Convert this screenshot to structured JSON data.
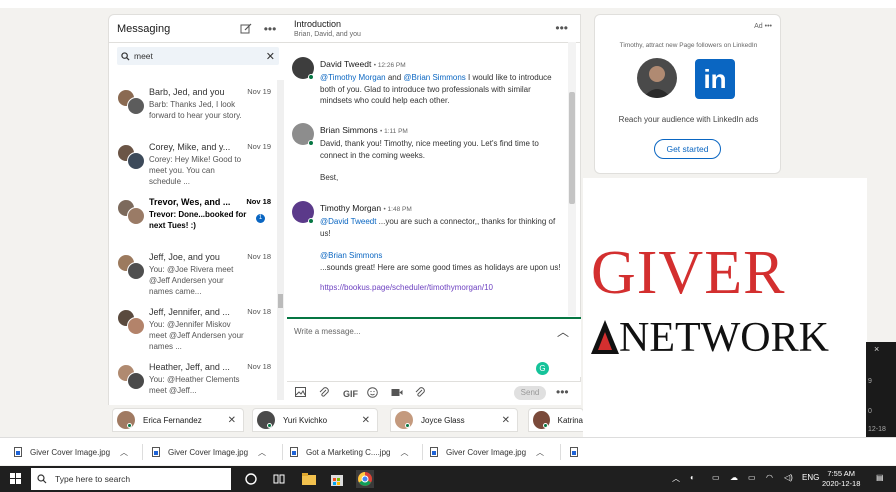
{
  "messaging": {
    "title": "Messaging",
    "search_value": "meet",
    "conversations": [
      {
        "name": "Barb, Jed, and you",
        "date": "Nov 19",
        "preview": "Barb: Thanks Jed, I look forward to hear your story.",
        "unread": false
      },
      {
        "name": "Corey, Mike, and y...",
        "date": "Nov 19",
        "preview": "Corey: Hey Mike! Good to meet you. You can schedule ...",
        "unread": false
      },
      {
        "name": "Trevor, Wes, and ...",
        "date": "Nov 18",
        "preview": "Trevor: Done...booked for next Tues! :)",
        "unread": true,
        "badge": "1"
      },
      {
        "name": "Jeff, Joe, and you",
        "date": "Nov 18",
        "preview": "You: @Joe Rivera meet @Jeff Andersen your names came...",
        "unread": false
      },
      {
        "name": "Jeff, Jennifer, and ...",
        "date": "Nov 18",
        "preview": "You: @Jennifer Miskov meet @Jeff Andersen your names ...",
        "unread": false
      },
      {
        "name": "Heather, Jeff, and ...",
        "date": "Nov 18",
        "preview": "You: @Heather Clements meet @Jeff...",
        "unread": false
      }
    ]
  },
  "chat": {
    "title": "Introduction",
    "subtitle": "Brian, David, and you",
    "messages": [
      {
        "sender": "David Tweedt",
        "time": "• 12:26 PM",
        "parts": [
          "@Timothy Morgan",
          " and ",
          "@Brian Simmons",
          " I would like to introduce both of you.  Glad to introduce two professionals with similar mindsets who could help each other."
        ]
      },
      {
        "sender": "Brian Simmons",
        "time": "• 1:11 PM",
        "body": "David, thank you!  Timothy, nice meeting you.  Let's find time to connect in the coming weeks.",
        "body2": "Best,"
      },
      {
        "sender": "Timothy Morgan",
        "time": "• 1:48 PM",
        "mention1": "@David Tweedt",
        "text1": " ...you are such a connector,, thanks for thinking of us!",
        "mention2": "@Brian Simmons",
        "text2": "...sounds great! Here are some good times as holidays are upon us!",
        "link": "https://bookus.page/scheduler/timothymorgan/10"
      }
    ],
    "compose_placeholder": "Write a message...",
    "gif_label": "GIF",
    "send_label": "Send"
  },
  "bubbles": [
    {
      "name": "Erica Fernandez"
    },
    {
      "name": "Yuri Kvichko"
    },
    {
      "name": "Joyce Glass"
    },
    {
      "name": "Katrina"
    }
  ],
  "ad": {
    "label": "Ad",
    "line1": "Timothy, attract new Page followers on LinkedIn",
    "logo_text": "in",
    "line2": "Reach your audience with LinkedIn ads",
    "button": "Get started"
  },
  "overlay": {
    "word1": "GIVER",
    "word2": "NETWORK",
    "strip_close": "×",
    "strip_text": [
      "9",
      "0",
      "12-18"
    ]
  },
  "downloads": [
    {
      "name": "Giver Cover Image.jpg"
    },
    {
      "name": "Giver Cover Image.jpg"
    },
    {
      "name": "Got a Marketing C....jpg"
    },
    {
      "name": "Giver Cover Image.jpg"
    }
  ],
  "taskbar": {
    "search_placeholder": "Type here to search",
    "lang": "ENG",
    "time": "7:55 AM",
    "date": "2020-12-18"
  },
  "colors": {
    "linkedin_blue": "#0a66c2",
    "online_green": "#057642",
    "giver_red": "#d32f2f"
  }
}
